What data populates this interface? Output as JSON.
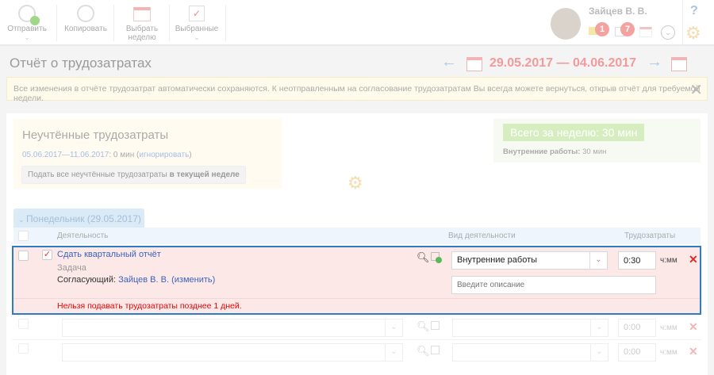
{
  "toolbar": {
    "send": "Отправить",
    "copy": "Копировать",
    "select_week_1": "Выбрать",
    "select_week_2": "неделю",
    "favorites": "Выбранные"
  },
  "user": {
    "name": "Зайцев В. В.",
    "mail_count": "1",
    "tasks_count": "7",
    "help": "?"
  },
  "page": {
    "title": "Отчёт о трудозатратах",
    "date_range": "29.05.2017 — 04.06.2017"
  },
  "notice": "Все изменения в отчёте трудозатрат автоматически сохраняются. К неотправленным на согласование трудозатратам Вы всегда можете вернуться, открыв отчёт для требуемой недели.",
  "unaccounted": {
    "title": "Неучтённые трудозатраты",
    "range": "05.06.2017—11.06.2017",
    "amount": ": 0 мин (",
    "ignore": "игнорировать",
    "close_paren": ")",
    "submit_prefix": "Подать все неучтённые трудозатраты ",
    "submit_bold": "в текущей неделе"
  },
  "total": {
    "label": "Всего за неделю: 30 мин",
    "type": "Внутренние работы:",
    "type_value": " 30 мин"
  },
  "day": {
    "label": "Понедельник (29.05.2017)"
  },
  "columns": {
    "activity": "Деятельность",
    "type": "Вид деятельности",
    "effort": "Трудозатраты"
  },
  "entry": {
    "name": "Сдать квартальный отчёт",
    "kind": "Задача",
    "approver_label": "Согласующий: ",
    "approver": "Зайцев В. В.",
    "change": "(изменить)",
    "type": "Внутренние работы",
    "time": "0:30",
    "unit": "ч:мм",
    "desc_placeholder": "Введите описание",
    "error": "Нельзя подавать трудозатраты позднее 1 дней."
  },
  "empty_rows": [
    {
      "time": "0:00",
      "unit": "ч:мм"
    },
    {
      "time": "0:00",
      "unit": "ч:мм"
    }
  ]
}
